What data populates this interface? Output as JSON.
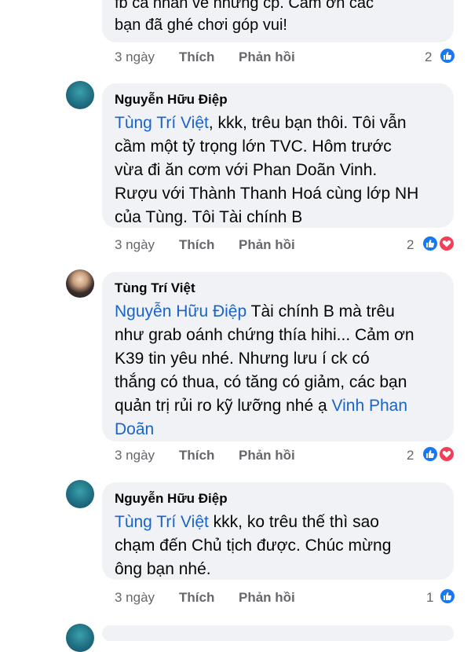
{
  "comment0": {
    "text_lines": [
      "fb cá nhân về những cp. Cảm ơn các",
      "bạn đã ghé chơi góp vui!"
    ],
    "time": "3 ngày",
    "like": "Thích",
    "reply": "Phản hồi",
    "reaction_count": "2"
  },
  "comment1": {
    "author": "Nguyễn Hữu Điệp",
    "mention": "Tùng Trí Việt",
    "lines": [
      ", kkk, trêu bạn thôi. Tôi vẫn",
      "cầm một tỷ trọng lớn TVC. Hôm trước",
      "vừa đi ăn cơm với Phan Doãn Vinh.",
      "Rượu với Thành Thanh Hoá cùng lớp NH",
      "của Tùng. Tôi Tài chính B"
    ],
    "time": "3 ngày",
    "like": "Thích",
    "reply": "Phản hồi",
    "reaction_count": "2"
  },
  "comment2": {
    "author": "Tùng Trí Việt",
    "mention": "Nguyễn Hữu Điệp",
    "lines": [
      " Tài chính B mà trêu",
      "như grab oánh chứng thía hihi... Cảm ơn",
      "K39 tin yêu nhé. Nhưng lưu í ck có",
      "thắng có thua, có tăng có giảm, các bạn",
      "quản trị rủi ro kỹ lưỡng nhé ạ "
    ],
    "mention_end_1": "Vinh Phan",
    "mention_end_2": "Doãn",
    "time": "3 ngày",
    "like": "Thích",
    "reply": "Phản hồi",
    "reaction_count": "2"
  },
  "comment3": {
    "author": "Nguyễn Hữu Điệp",
    "mention": "Tùng Trí Việt",
    "lines": [
      " kkk, ko trêu thế thì sao",
      "chạm đến Chủ tịch được. Chúc mừng",
      "ông bạn nhé."
    ],
    "time": "3 ngày",
    "like": "Thích",
    "reply": "Phản hồi",
    "reaction_count": "1"
  },
  "colors": {
    "mention": "#1a63c9",
    "bubble": "#f0f2f5",
    "meta": "#65676b",
    "like": "#1877f2",
    "love": "#f33e58"
  },
  "icons": {
    "like": "thumbs-up-icon",
    "love": "heart-icon"
  }
}
